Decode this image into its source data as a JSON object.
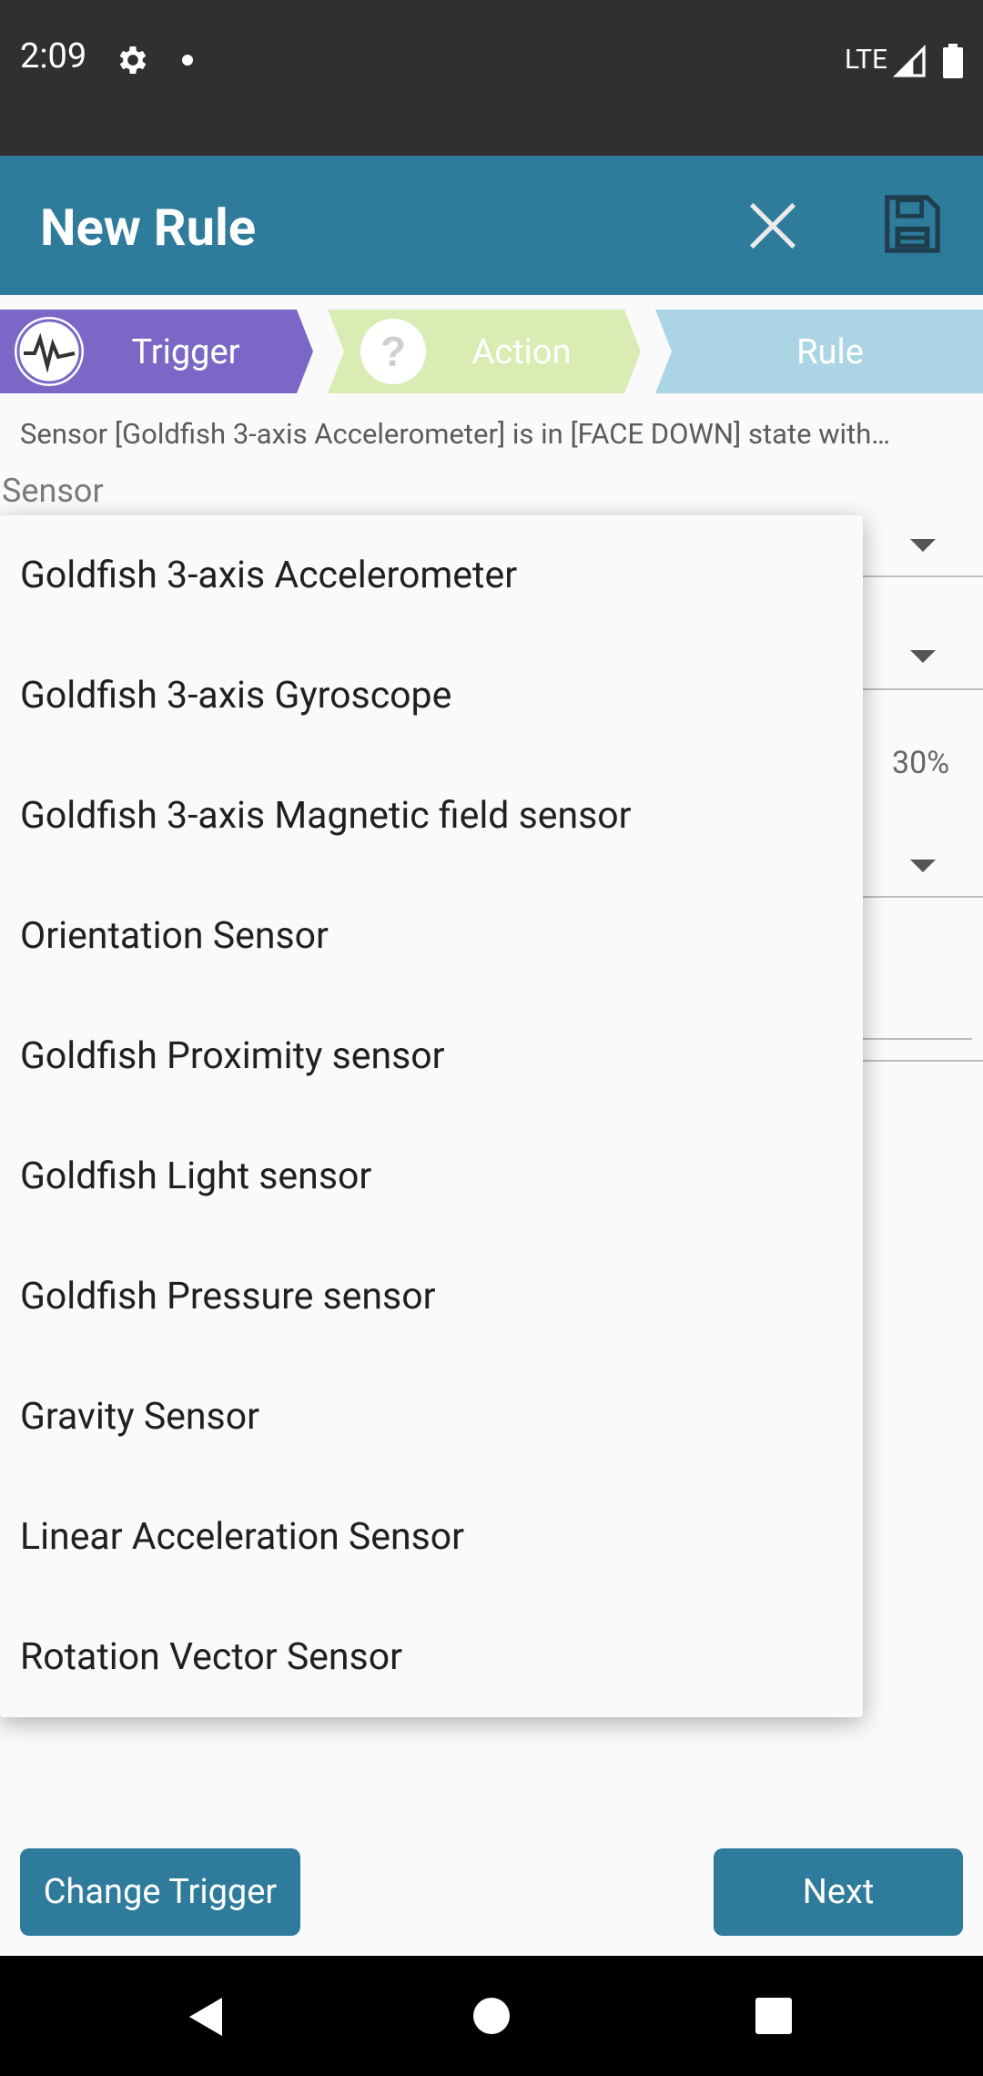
{
  "status_bar": {
    "time": "2:09",
    "network": "LTE"
  },
  "app_bar": {
    "title": "New Rule",
    "close_icon": "close-icon",
    "save_icon": "save-icon"
  },
  "steps": [
    {
      "label": "Trigger",
      "icon": "sensor-wave-icon",
      "color": "#7b68c6"
    },
    {
      "label": "Action",
      "icon": "question-icon",
      "color": "#d9ecb4"
    },
    {
      "label": "Rule",
      "icon": "",
      "color": "#abd5e4"
    }
  ],
  "summary": "Sensor [Goldfish 3-axis Accelerometer] is in [FACE DOWN] state with…",
  "sensor_label": "Sensor",
  "background_value_percent": "30%",
  "dropdown": {
    "items": [
      "Goldfish 3-axis Accelerometer",
      "Goldfish 3-axis Gyroscope",
      "Goldfish 3-axis Magnetic field sensor",
      "Orientation Sensor",
      "Goldfish Proximity sensor",
      "Goldfish Light sensor",
      "Goldfish Pressure sensor",
      "Gravity Sensor",
      "Linear Acceleration Sensor",
      "Rotation Vector Sensor"
    ]
  },
  "buttons": {
    "change_trigger": "Change Trigger",
    "next": "Next"
  },
  "colors": {
    "accent": "#2e7b9b",
    "status_bar": "#303030",
    "nav_bar": "#000000"
  }
}
